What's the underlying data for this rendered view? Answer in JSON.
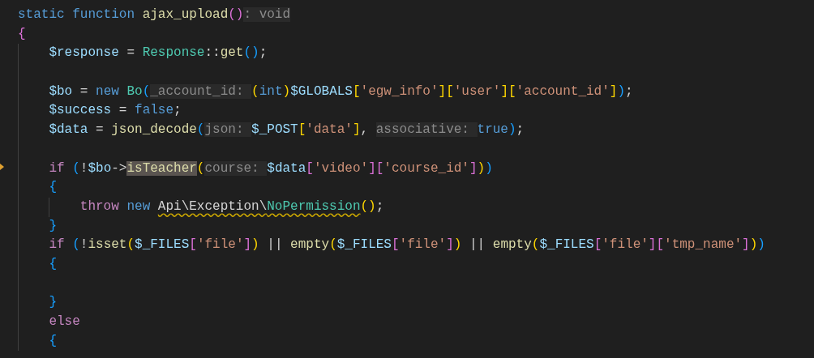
{
  "editor": {
    "lines": [
      {
        "kind": "code",
        "tokens": [
          {
            "text": "static",
            "kind": "keyword"
          },
          {
            "text": " function",
            "kind": "keyword"
          },
          {
            "text": " ajax_upload",
            "kind": "function"
          },
          {
            "text": "()",
            "kind": "bracket2"
          },
          {
            "text": ": void",
            "kind": "hint"
          }
        ]
      },
      {
        "kind": "code",
        "tokens": [
          {
            "text": "{",
            "kind": "bracket2"
          }
        ]
      },
      {
        "kind": "code",
        "tokens": [
          {
            "text": "    $response",
            "kind": "variable"
          },
          {
            "text": " = ",
            "kind": "plain"
          },
          {
            "text": "Response",
            "kind": "class"
          },
          {
            "text": "::",
            "kind": "plain"
          },
          {
            "text": "get",
            "kind": "function"
          },
          {
            "text": "()",
            "kind": "bracket3"
          },
          {
            "text": ";",
            "kind": "plain"
          }
        ]
      },
      {
        "kind": "blank"
      },
      {
        "kind": "code",
        "tokens": [
          {
            "text": "    $bo",
            "kind": "variable"
          },
          {
            "text": " = ",
            "kind": "plain"
          },
          {
            "text": "new",
            "kind": "keyword"
          },
          {
            "text": " Bo",
            "kind": "class"
          },
          {
            "text": "(",
            "kind": "bracket3"
          },
          {
            "text": "_account_id: ",
            "kind": "hint"
          },
          {
            "text": "(",
            "kind": "bracket1"
          },
          {
            "text": "int",
            "kind": "keyword"
          },
          {
            "text": ")",
            "kind": "bracket1"
          },
          {
            "text": "$GLOBALS",
            "kind": "variable"
          },
          {
            "text": "[",
            "kind": "bracket1"
          },
          {
            "text": "'egw_info'",
            "kind": "string"
          },
          {
            "text": "][",
            "kind": "bracket1"
          },
          {
            "text": "'user'",
            "kind": "string"
          },
          {
            "text": "][",
            "kind": "bracket1"
          },
          {
            "text": "'account_id'",
            "kind": "string"
          },
          {
            "text": "]",
            "kind": "bracket1"
          },
          {
            "text": ")",
            "kind": "bracket3"
          },
          {
            "text": ";",
            "kind": "plain"
          }
        ]
      },
      {
        "kind": "code",
        "tokens": [
          {
            "text": "    $success",
            "kind": "variable"
          },
          {
            "text": " = ",
            "kind": "plain"
          },
          {
            "text": "false",
            "kind": "keyword"
          },
          {
            "text": ";",
            "kind": "plain"
          }
        ]
      },
      {
        "kind": "code",
        "tokens": [
          {
            "text": "    $data",
            "kind": "variable"
          },
          {
            "text": " = ",
            "kind": "plain"
          },
          {
            "text": "json_decode",
            "kind": "function"
          },
          {
            "text": "(",
            "kind": "bracket3"
          },
          {
            "text": "json: ",
            "kind": "hint"
          },
          {
            "text": "$_POST",
            "kind": "variable"
          },
          {
            "text": "[",
            "kind": "bracket1"
          },
          {
            "text": "'data'",
            "kind": "string"
          },
          {
            "text": "]",
            "kind": "bracket1"
          },
          {
            "text": ", ",
            "kind": "plain"
          },
          {
            "text": "associative: ",
            "kind": "hint"
          },
          {
            "text": "true",
            "kind": "keyword"
          },
          {
            "text": ")",
            "kind": "bracket3"
          },
          {
            "text": ";",
            "kind": "plain"
          }
        ]
      },
      {
        "kind": "blank"
      },
      {
        "kind": "code",
        "tokens": [
          {
            "text": "    if",
            "kind": "control"
          },
          {
            "text": " (",
            "kind": "bracket3"
          },
          {
            "text": "!",
            "kind": "plain"
          },
          {
            "text": "$bo",
            "kind": "variable"
          },
          {
            "text": "->",
            "kind": "plain"
          },
          {
            "text": "isTeacher",
            "kind": "match-function"
          },
          {
            "text": "(",
            "kind": "bracket1"
          },
          {
            "text": "course: ",
            "kind": "hint"
          },
          {
            "text": "$data",
            "kind": "variable"
          },
          {
            "text": "[",
            "kind": "bracket2"
          },
          {
            "text": "'video'",
            "kind": "string"
          },
          {
            "text": "][",
            "kind": "bracket2"
          },
          {
            "text": "'course_id'",
            "kind": "string"
          },
          {
            "text": "]",
            "kind": "bracket2"
          },
          {
            "text": ")",
            "kind": "bracket1"
          },
          {
            "text": ")",
            "kind": "bracket3"
          }
        ]
      },
      {
        "kind": "code",
        "tokens": [
          {
            "text": "    {",
            "kind": "bracket3"
          }
        ]
      },
      {
        "kind": "code",
        "tokens": [
          {
            "text": "        throw",
            "kind": "control"
          },
          {
            "text": " new ",
            "kind": "keyword"
          },
          {
            "text": "Api\\Exception\\",
            "kind": "warn-plain"
          },
          {
            "text": "NoPermission",
            "kind": "warn-class"
          },
          {
            "text": "()",
            "kind": "bracket1"
          },
          {
            "text": ";",
            "kind": "plain"
          }
        ]
      },
      {
        "kind": "code",
        "tokens": [
          {
            "text": "    }",
            "kind": "bracket3"
          }
        ]
      },
      {
        "kind": "code",
        "tokens": [
          {
            "text": "    if",
            "kind": "control"
          },
          {
            "text": " (",
            "kind": "bracket3"
          },
          {
            "text": "!",
            "kind": "plain"
          },
          {
            "text": "isset",
            "kind": "function"
          },
          {
            "text": "(",
            "kind": "bracket1"
          },
          {
            "text": "$_FILES",
            "kind": "variable"
          },
          {
            "text": "[",
            "kind": "bracket2"
          },
          {
            "text": "'file'",
            "kind": "string"
          },
          {
            "text": "]",
            "kind": "bracket2"
          },
          {
            "text": ")",
            "kind": "bracket1"
          },
          {
            "text": " || ",
            "kind": "plain"
          },
          {
            "text": "empty",
            "kind": "function"
          },
          {
            "text": "(",
            "kind": "bracket1"
          },
          {
            "text": "$_FILES",
            "kind": "variable"
          },
          {
            "text": "[",
            "kind": "bracket2"
          },
          {
            "text": "'file'",
            "kind": "string"
          },
          {
            "text": "]",
            "kind": "bracket2"
          },
          {
            "text": ")",
            "kind": "bracket1"
          },
          {
            "text": " || ",
            "kind": "plain"
          },
          {
            "text": "empty",
            "kind": "function"
          },
          {
            "text": "(",
            "kind": "bracket1"
          },
          {
            "text": "$_FILES",
            "kind": "variable"
          },
          {
            "text": "[",
            "kind": "bracket2"
          },
          {
            "text": "'file'",
            "kind": "string"
          },
          {
            "text": "][",
            "kind": "bracket2"
          },
          {
            "text": "'tmp_name'",
            "kind": "string"
          },
          {
            "text": "]",
            "kind": "bracket2"
          },
          {
            "text": ")",
            "kind": "bracket1"
          },
          {
            "text": ")",
            "kind": "bracket3"
          }
        ]
      },
      {
        "kind": "code",
        "tokens": [
          {
            "text": "    {",
            "kind": "bracket3"
          }
        ]
      },
      {
        "kind": "blank"
      },
      {
        "kind": "code",
        "tokens": [
          {
            "text": "    }",
            "kind": "bracket3"
          }
        ]
      },
      {
        "kind": "code",
        "tokens": [
          {
            "text": "    else",
            "kind": "control"
          }
        ]
      },
      {
        "kind": "code",
        "tokens": [
          {
            "text": "    {",
            "kind": "bracket3"
          }
        ]
      }
    ]
  }
}
